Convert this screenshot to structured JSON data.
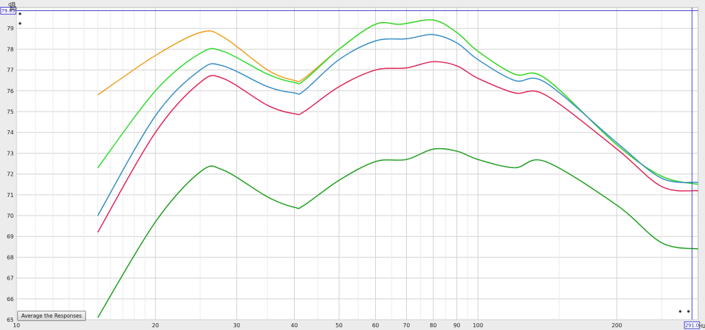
{
  "chart_data": {
    "type": "line",
    "x_axis": {
      "scale": "log",
      "unit": "Hz",
      "range": [
        10,
        300
      ],
      "ticks": [
        10,
        20,
        30,
        40,
        50,
        60,
        70,
        80,
        90,
        100,
        200
      ],
      "tick_labels": [
        "10",
        "20",
        "30",
        "40",
        "50",
        "60",
        "70",
        "80",
        "90",
        "100",
        "200"
      ]
    },
    "y_axis": {
      "unit": "dB",
      "range": [
        65,
        80
      ],
      "ticks": [
        65,
        66,
        67,
        68,
        69,
        70,
        71,
        72,
        73,
        74,
        75,
        76,
        77,
        78,
        79
      ],
      "tick_labels": [
        "65",
        "66",
        "67",
        "68",
        "69",
        "70",
        "71",
        "72",
        "73",
        "74",
        "75",
        "76",
        "77",
        "78",
        "79"
      ]
    },
    "grid": true,
    "series": [
      {
        "color": "#f0a020",
        "points": [
          [
            15,
            75.8
          ],
          [
            20,
            77.7
          ],
          [
            25,
            78.8
          ],
          [
            28,
            78.6
          ],
          [
            35,
            77.0
          ],
          [
            40,
            76.5
          ],
          [
            42,
            76.6
          ],
          [
            50,
            78.0
          ],
          [
            60,
            79.2
          ],
          [
            68,
            79.2
          ],
          [
            80,
            79.4
          ],
          [
            90,
            78.8
          ],
          [
            100,
            77.9
          ],
          [
            120,
            76.8
          ],
          [
            140,
            76.6
          ],
          [
            200,
            73.4
          ],
          [
            250,
            71.9
          ],
          [
            300,
            71.5
          ]
        ]
      },
      {
        "color": "#33dd33",
        "points": [
          [
            15,
            72.3
          ],
          [
            20,
            76.0
          ],
          [
            25,
            77.8
          ],
          [
            28,
            77.9
          ],
          [
            35,
            76.8
          ],
          [
            40,
            76.4
          ],
          [
            42,
            76.5
          ],
          [
            50,
            78.0
          ],
          [
            60,
            79.2
          ],
          [
            68,
            79.2
          ],
          [
            80,
            79.4
          ],
          [
            90,
            78.8
          ],
          [
            100,
            77.9
          ],
          [
            120,
            76.8
          ],
          [
            140,
            76.6
          ],
          [
            200,
            73.4
          ],
          [
            250,
            71.9
          ],
          [
            300,
            71.5
          ]
        ]
      },
      {
        "color": "#3a8fc8",
        "points": [
          [
            15,
            70.0
          ],
          [
            20,
            74.8
          ],
          [
            25,
            77.0
          ],
          [
            28,
            77.2
          ],
          [
            35,
            76.2
          ],
          [
            40,
            75.9
          ],
          [
            42,
            76.0
          ],
          [
            50,
            77.5
          ],
          [
            60,
            78.4
          ],
          [
            70,
            78.5
          ],
          [
            80,
            78.7
          ],
          [
            90,
            78.3
          ],
          [
            100,
            77.5
          ],
          [
            120,
            76.5
          ],
          [
            140,
            76.4
          ],
          [
            200,
            73.5
          ],
          [
            250,
            71.8
          ],
          [
            300,
            71.6
          ]
        ]
      },
      {
        "color": "#e0285a",
        "points": [
          [
            15,
            69.2
          ],
          [
            20,
            74.0
          ],
          [
            25,
            76.4
          ],
          [
            28,
            76.6
          ],
          [
            35,
            75.3
          ],
          [
            40,
            74.9
          ],
          [
            42,
            75.0
          ],
          [
            50,
            76.2
          ],
          [
            60,
            77.0
          ],
          [
            70,
            77.1
          ],
          [
            80,
            77.4
          ],
          [
            90,
            77.2
          ],
          [
            100,
            76.6
          ],
          [
            120,
            75.9
          ],
          [
            140,
            75.8
          ],
          [
            200,
            73.2
          ],
          [
            250,
            71.4
          ],
          [
            300,
            71.2
          ]
        ]
      },
      {
        "color": "#22a022",
        "points": [
          [
            15,
            65.1
          ],
          [
            20,
            69.7
          ],
          [
            25,
            72.1
          ],
          [
            28,
            72.2
          ],
          [
            35,
            70.9
          ],
          [
            40,
            70.4
          ],
          [
            42,
            70.5
          ],
          [
            50,
            71.7
          ],
          [
            60,
            72.6
          ],
          [
            70,
            72.7
          ],
          [
            80,
            73.2
          ],
          [
            90,
            73.1
          ],
          [
            100,
            72.7
          ],
          [
            120,
            72.3
          ],
          [
            140,
            72.6
          ],
          [
            200,
            70.5
          ],
          [
            250,
            68.7
          ],
          [
            300,
            68.4
          ]
        ]
      }
    ]
  },
  "axes": {
    "y_unit_label": "dB",
    "x_unit_label": "Hz",
    "y_top_label": "80"
  },
  "cursor": {
    "y_value": "79.85",
    "x_value": "291.0"
  },
  "button": {
    "label": "Average the Responses"
  },
  "colors": {
    "plot_bg": "#ffffff",
    "grid": "#d0d0d0",
    "cursor": "#3a3ad0"
  }
}
